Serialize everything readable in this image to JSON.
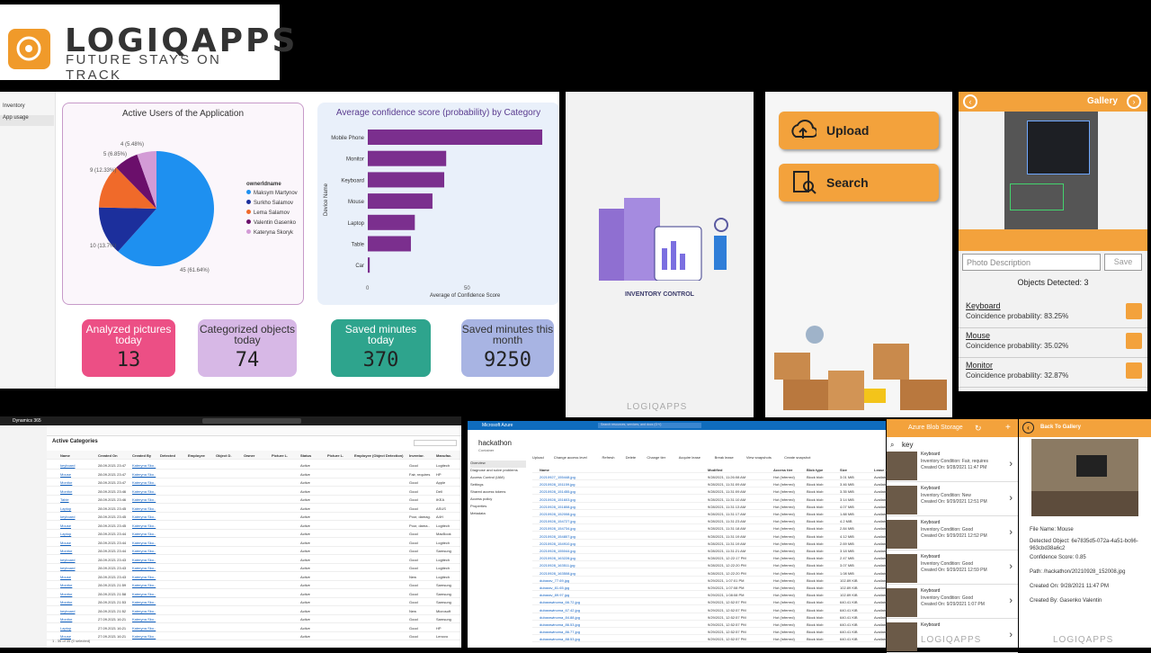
{
  "logo": {
    "name": "LOGIQAPPS",
    "tagline": "FUTURE STAYS ON TRACK"
  },
  "dashboard": {
    "nav": [
      "Inventory",
      "App usage"
    ],
    "pie": {
      "title": "Active Users of the Application",
      "legend_title": "ownerIdname",
      "legend": [
        "Maksym Martynov",
        "Surkho Salamov",
        "Lema Salamov",
        "Valentin Gasenko",
        "Kateryna Skoryk"
      ],
      "labels": [
        "45 (61.64%)",
        "10 (13.7%)",
        "9 (12.33%)",
        "5 (6.85%)",
        "4 (5.48%)"
      ]
    },
    "bar": {
      "title": "Average confidence score (probability) by Category",
      "ylabel": "Device Name",
      "xlabel": "Average of Confidence Score",
      "categories": [
        "Mobile Phone",
        "Monitor",
        "Keyboard",
        "Mouse",
        "Laptop",
        "Table",
        "Car"
      ],
      "ticks": [
        "0",
        "50"
      ]
    },
    "kpis": [
      {
        "label": "Analyzed pictures today",
        "value": "13"
      },
      {
        "label": "Categorized objects today",
        "value": "74"
      },
      {
        "label": "Saved minutes today",
        "value": "370"
      },
      {
        "label": "Saved minutes this month",
        "value": "9250"
      }
    ]
  },
  "chart_data": {
    "type": "pie",
    "title": "Active Users of the Application",
    "series": [
      {
        "name": "Maksym Martynov",
        "value": 45,
        "percent": 61.64
      },
      {
        "name": "Surkho Salamov",
        "value": 10,
        "percent": 13.7
      },
      {
        "name": "Lema Salamov",
        "value": 9,
        "percent": 12.33
      },
      {
        "name": "Valentin Gasenko",
        "value": 5,
        "percent": 6.85
      },
      {
        "name": "Kateryna Skoryk",
        "value": 4,
        "percent": 5.48
      }
    ],
    "colors": [
      "#1e90f0",
      "#1c2f9c",
      "#f06a2a",
      "#6b0f6b",
      "#d39bd6"
    ],
    "bar_chart": {
      "type": "bar",
      "title": "Average confidence score (probability) by Category",
      "categories": [
        "Mobile Phone",
        "Monitor",
        "Keyboard",
        "Mouse",
        "Laptop",
        "Table",
        "Car"
      ],
      "values": [
        89,
        40,
        39,
        33,
        24,
        22,
        1
      ],
      "xlim": [
        0,
        100
      ],
      "xlabel": "Average of Confidence Score",
      "ylabel": "Device Name"
    }
  },
  "phone1": {
    "caption": "INVENTORY CONTROL",
    "brand": "LOGIQAPPS"
  },
  "phone2": {
    "upload_label": "Upload",
    "search_label": "Search"
  },
  "gallery": {
    "title": "Gallery",
    "description_placeholder": "Photo Description",
    "save_label": "Save",
    "detected": "Objects Detected: 3",
    "items": [
      {
        "name": "Keyboard",
        "prob": "Coincidence probability: 83.25%"
      },
      {
        "name": "Mouse",
        "prob": "Coincidence probability: 35.02%"
      },
      {
        "name": "Monitor",
        "prob": "Coincidence probability: 32.87%"
      }
    ],
    "brand": "LOGIQAPPS"
  },
  "dynamics": {
    "app": "Dynamics 365",
    "view_title": "Active Categories",
    "columns": [
      "Name",
      "Created On",
      "Created By",
      "Detected",
      "Employee",
      "Object D.",
      "Owner",
      "Picture L.",
      "Status",
      "Picture L.",
      "Employee (Object Detection)",
      "Inventor.",
      "Manufac."
    ],
    "rows": [
      [
        "keyboard",
        "28.09.2021 23:47",
        "Kateryna Sko..",
        "Active",
        "Good",
        "Logitech"
      ],
      [
        "Mouse",
        "28.09.2021 23:47",
        "Kateryna Sko..",
        "Active",
        "Fair, requires",
        "HP"
      ],
      [
        "Monitor",
        "28.09.2021 23:47",
        "Kateryna Sko..",
        "Active",
        "Good",
        "Apple"
      ],
      [
        "Monitor",
        "28.09.2021 23:46",
        "Kateryna Sko..",
        "Active",
        "Good",
        "Dell"
      ],
      [
        "Table",
        "28.09.2021 23:46",
        "Kateryna Sko..",
        "Active",
        "Good",
        "IKEA"
      ],
      [
        "Laptop",
        "28.09.2021 23:45",
        "Kateryna Sko..",
        "Active",
        "Good",
        "ASUS"
      ],
      [
        "keyboard",
        "28.09.2021 23:45",
        "Kateryna Sko..",
        "Active",
        "Poor, damag.",
        "A4H"
      ],
      [
        "Mouse",
        "28.09.2021 23:45",
        "Kateryna Sko..",
        "Active",
        "Poor, dama..",
        "Logitech"
      ],
      [
        "Laptop",
        "28.09.2021 23:44",
        "Kateryna Sko..",
        "Active",
        "Good",
        "MacBook"
      ],
      [
        "Mouse",
        "28.09.2021 23:44",
        "Kateryna Sko..",
        "Active",
        "Good",
        "Logitech"
      ],
      [
        "Monitor",
        "28.09.2021 23:44",
        "Kateryna Sko..",
        "Active",
        "Good",
        "Samsung"
      ],
      [
        "keyboard",
        "28.09.2021 23:43",
        "Kateryna Sko..",
        "Active",
        "Good",
        "Logitech"
      ],
      [
        "keyboard",
        "28.09.2021 23:43",
        "Kateryna Sko..",
        "Active",
        "Good",
        "Logitech"
      ],
      [
        "Mouse",
        "28.09.2021 23:43",
        "Kateryna Sko..",
        "Active",
        "New",
        "Logitech"
      ],
      [
        "Monitor",
        "28.09.2021 21:59",
        "Kateryna Sko..",
        "Active",
        "Good",
        "Samsung"
      ],
      [
        "Monitor",
        "28.09.2021 21:58",
        "Kateryna Sko..",
        "Active",
        "Good",
        "Samsung"
      ],
      [
        "Monitor",
        "28.09.2021 21:53",
        "Kateryna Sko..",
        "Active",
        "Good",
        "Samsung"
      ],
      [
        "keyboard",
        "28.09.2021 21:52",
        "Kateryna Sko..",
        "Active",
        "New",
        "Microsoft"
      ],
      [
        "Monitor",
        "27.09.2021 16:21",
        "Kateryna Sko..",
        "Active",
        "Good",
        "Samsung"
      ],
      [
        "Laptop",
        "27.09.2021 16:21",
        "Kateryna Sko..",
        "Active",
        "Good",
        "HP"
      ],
      [
        "Mouse",
        "27.09.2021 16:21",
        "Kateryna Sko..",
        "Active",
        "Good",
        "Lenovo"
      ]
    ],
    "footer": "1 - 35 of 35 (0 selected)"
  },
  "azure": {
    "title": "Microsoft Azure",
    "search_placeholder": "Search resources, services, and docs (G+/)",
    "container": "hackathon",
    "container_type": "Container",
    "menu": [
      "Overview",
      "Diagnose and solve problems",
      "Access Control (IAM)",
      "Settings",
      "Shared access tokens",
      "Access policy",
      "Properties",
      "Metadata"
    ],
    "toolbar": [
      "Upload",
      "Change access level",
      "Refresh",
      "Delete",
      "Change tier",
      "Acquire lease",
      "Break lease",
      "View snapshots",
      "Create snapshot"
    ],
    "columns": [
      "Name",
      "Modified",
      "Access tier",
      "Blob type",
      "Size",
      "Lease state"
    ],
    "rows": [
      [
        "20210927_155448.jpg",
        "9/28/2021, 11:26:08 AM",
        "Hot (Inferred)",
        "Block blob",
        "3.01 MiB",
        "Available"
      ],
      [
        "20210928_151159.jpg",
        "9/28/2021, 11:31:09 AM",
        "Hot (Inferred)",
        "Block blob",
        "3.46 MiB",
        "Available"
      ],
      [
        "20210928_151455.jpg",
        "9/28/2021, 11:31:09 AM",
        "Hot (Inferred)",
        "Block blob",
        "3.35 MiB",
        "Available"
      ],
      [
        "20210928_151603.jpg",
        "9/28/2021, 11:31:10 AM",
        "Hot (Inferred)",
        "Block blob",
        "3.14 MiB",
        "Available"
      ],
      [
        "20210928_151808.jpg",
        "9/28/2021, 11:31:13 AM",
        "Hot (Inferred)",
        "Block blob",
        "4.07 MiB",
        "Available"
      ],
      [
        "20210928_152008.jpg",
        "9/28/2021, 11:31:17 AM",
        "Hot (Inferred)",
        "Block blob",
        "1.88 MiB",
        "Available"
      ],
      [
        "20210928_154727.jpg",
        "9/28/2021, 11:31:23 AM",
        "Hot (Inferred)",
        "Block blob",
        "4.2 MiB",
        "Available"
      ],
      [
        "20210928_154734.jpg",
        "9/28/2021, 11:31:18 AM",
        "Hot (Inferred)",
        "Block blob",
        "2.84 MiB",
        "Available"
      ],
      [
        "20210928_154807.jpg",
        "9/28/2021, 11:31:19 AM",
        "Hot (Inferred)",
        "Block blob",
        "4.12 MiB",
        "Available"
      ],
      [
        "20210928_154910.jpg",
        "9/28/2021, 11:31:19 AM",
        "Hot (Inferred)",
        "Block blob",
        "2.69 MiB",
        "Available"
      ],
      [
        "20210928_155044.jpg",
        "9/28/2021, 11:31:21 AM",
        "Hot (Inferred)",
        "Block blob",
        "3.18 MiB",
        "Available"
      ],
      [
        "20210928_163228.jpg",
        "9/28/2021, 12:22:17 PM",
        "Hot (Inferred)",
        "Block blob",
        "2.47 MiB",
        "Available"
      ],
      [
        "20210928_163511.jpg",
        "9/28/2021, 12:22:20 PM",
        "Hot (Inferred)",
        "Block blob",
        "3.07 MiB",
        "Available"
      ],
      [
        "20210928_163508.jpg",
        "9/28/2021, 12:22:20 PM",
        "Hot (Inferred)",
        "Block blob",
        "1.08 MiB",
        "Available"
      ],
      [
        "dubarav_77.69.jpg",
        "9/29/2021, 1:07:01 PM",
        "Hot (Inferred)",
        "Block blob",
        "102.89 KiB",
        "Available"
      ],
      [
        "dubarav_81.65.jpg",
        "9/29/2021, 1:07:08 PM",
        "Hot (Inferred)",
        "Block blob",
        "102.89 KiB",
        "Available"
      ],
      [
        "dubarav_89.97.jpg",
        "9/29/2021, 1:08:08 PM",
        "Hot (Inferred)",
        "Block blob",
        "102.89 KiB",
        "Available"
      ],
      [
        "dubarawinoma_66.72.jpg",
        "9/29/2021, 12:52:57 PM",
        "Hot (Inferred)",
        "Block blob",
        "640.41 KiB",
        "Available"
      ],
      [
        "dubarawinoma_67.42.jpg",
        "9/29/2021, 12:52:57 PM",
        "Hot (Inferred)",
        "Block blob",
        "640.41 KiB",
        "Available"
      ],
      [
        "dubarawinoma_84.88.jpg",
        "9/29/2021, 12:52:57 PM",
        "Hot (Inferred)",
        "Block blob",
        "640.41 KiB",
        "Available"
      ],
      [
        "dubarawinoma_86.53.jpg",
        "9/29/2021, 12:52:57 PM",
        "Hot (Inferred)",
        "Block blob",
        "640.41 KiB",
        "Available"
      ],
      [
        "dubarawinoma_86.77.jpg",
        "9/29/2021, 12:52:57 PM",
        "Hot (Inferred)",
        "Block blob",
        "640.41 KiB",
        "Available"
      ],
      [
        "dubarawinoma_88.53.jpg",
        "9/29/2021, 12:52:57 PM",
        "Hot (Inferred)",
        "Block blob",
        "640.41 KiB",
        "Available"
      ]
    ]
  },
  "blob": {
    "title": "Azure Blob Storage",
    "search_value": "key",
    "items": [
      {
        "name": "Keyboard",
        "condition": "Inventory Condition: Fair, requires",
        "created": "Created On: 9/28/2021 11:47 PM"
      },
      {
        "name": "Keyboard",
        "condition": "Inventory Condition: New",
        "created": "Created On: 9/29/2021 12:51 PM"
      },
      {
        "name": "Keyboard",
        "condition": "Inventory Condition: Good",
        "created": "Created On: 9/29/2021 12:52 PM"
      },
      {
        "name": "Keyboard",
        "condition": "Inventory Condition: Good",
        "created": "Created On: 9/29/2021 12:59 PM"
      },
      {
        "name": "Keyboard",
        "condition": "Inventory Condition: Good",
        "created": "Created On: 9/29/2021 1:07 PM"
      },
      {
        "name": "Keyboard",
        "condition": "",
        "created": ""
      }
    ],
    "brand": "LOGIQAPPS"
  },
  "detail": {
    "title": "Back To Gallery",
    "file_name": "File Name: Mouse",
    "detected": "Detected Object: 6e7835d5-072a-4a51-bc66-963cbd38a6c2",
    "confidence": "Confidence Score: 0.85",
    "path": "Path: /hackathon/20210928_152008.jpg",
    "created": "Created On: 9/28/2021 11:47 PM",
    "created_by": "Created By: Gasenko Valentin",
    "brand": "LOGIQAPPS"
  },
  "colors": {
    "accent": "#f3a23c",
    "kpi1": "#ec4f85",
    "kpi2": "#d7b8e6",
    "kpi3": "#2ea48d",
    "kpi4": "#a8b4e3",
    "bar": "#7b2f8e"
  }
}
